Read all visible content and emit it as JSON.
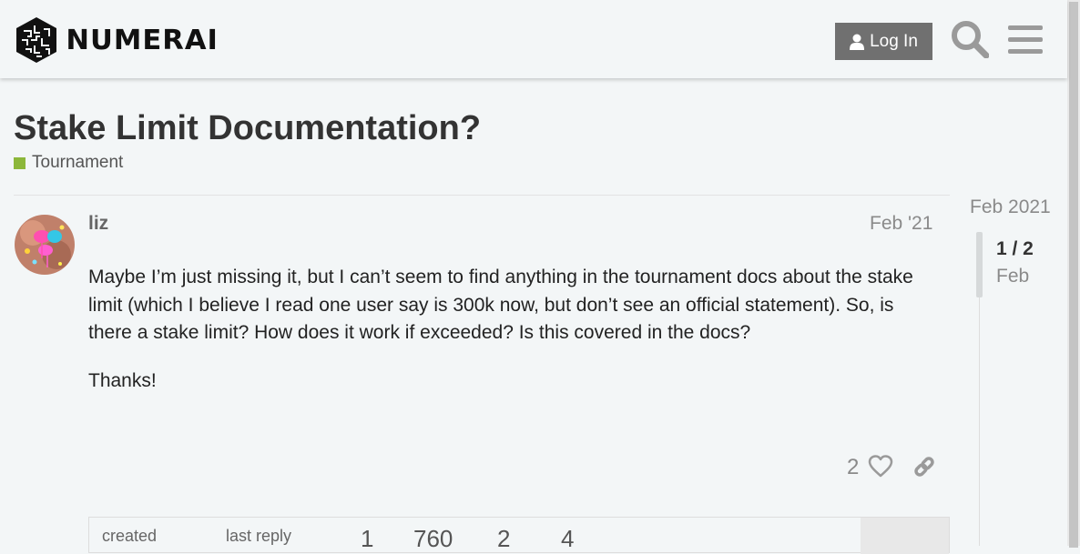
{
  "header": {
    "logo_text": "NUMERAI",
    "login_label": "Log In",
    "icons": [
      "person-icon",
      "search-icon",
      "menu-icon"
    ]
  },
  "topic": {
    "title": "Stake Limit Documentation?",
    "category": "Tournament",
    "category_color": "#8cb73a"
  },
  "post": {
    "username": "liz",
    "date": "Feb '21",
    "paragraphs": [
      "Maybe I’m just missing it, but I can’t seem to find anything in the tournament docs about the stake limit (which I believe I read one user say is 300k now, but don’t see an official statement). So, is there a stake limit? How does it work if exceeded? Is this covered in the docs?",
      "Thanks!"
    ],
    "likes": "2"
  },
  "topic_map": {
    "created_label": "created",
    "last_reply_label": "last reply",
    "stats": [
      "1",
      "760",
      "2",
      "4"
    ]
  },
  "timeline": {
    "top_date": "Feb 2021",
    "position": "1 / 2",
    "position_date": "Feb"
  }
}
